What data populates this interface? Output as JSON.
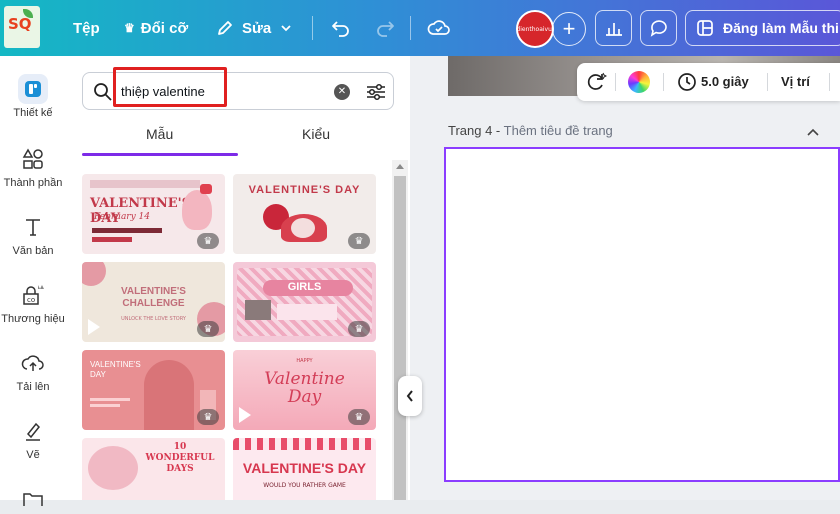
{
  "topbar": {
    "logo_text": "SQ",
    "file_label": "Tệp",
    "resize_label": "Đổi cỡ",
    "edit_label": "Sửa",
    "avatar_text": "dienthoaivui",
    "publish_label": "Đăng làm Mẫu thi",
    "gradient_start": "#14b8c4",
    "gradient_end": "#5a57d8"
  },
  "rail": {
    "items": [
      {
        "label": "Thiết kế",
        "icon": "design-icon"
      },
      {
        "label": "Thành phần",
        "icon": "elements-icon"
      },
      {
        "label": "Văn bản",
        "icon": "text-icon"
      },
      {
        "label": "Thương hiệu",
        "icon": "brand-icon"
      },
      {
        "label": "Tải lên",
        "icon": "upload-icon"
      },
      {
        "label": "Vẽ",
        "icon": "draw-icon"
      }
    ]
  },
  "panel": {
    "search": {
      "value": "thiệp valentine",
      "highlight_color": "#e02020"
    },
    "tabs": [
      {
        "label": "Mẫu",
        "active": true
      },
      {
        "label": "Kiểu",
        "active": false
      }
    ],
    "templates": [
      {
        "title": "VALENTINE'S DAY",
        "subtitle": "February 14",
        "bg": "#f6e8ea"
      },
      {
        "title": "VALENTINE'S DAY",
        "bg": "#f2ecea"
      },
      {
        "title": "VALENTINE'S CHALLENGE",
        "subtitle": "UNLOCK THE LOVE STORY",
        "bg": "#efe7dc"
      },
      {
        "title": "GIRLS",
        "bg": "#f4c9d8"
      },
      {
        "title": "VALENTINE'S DAY",
        "bg": "#e88f92"
      },
      {
        "title": "Valentine Day",
        "small": "HAPPY",
        "bg": "#f9cfd7"
      },
      {
        "title": "10 WONDERFUL DAYS",
        "bg": "#fbe6ea"
      },
      {
        "title": "VALENTINE'S DAY",
        "subtitle": "WOULD YOU RATHER GAME",
        "bg": "#fde9ef"
      }
    ]
  },
  "canvas": {
    "duration": "5.0 giây",
    "position_label": "Vị trí",
    "page_label": "Trang 4 -",
    "page_title_placeholder": "Thêm tiêu đề trang",
    "selection_color": "#8b3dff"
  }
}
